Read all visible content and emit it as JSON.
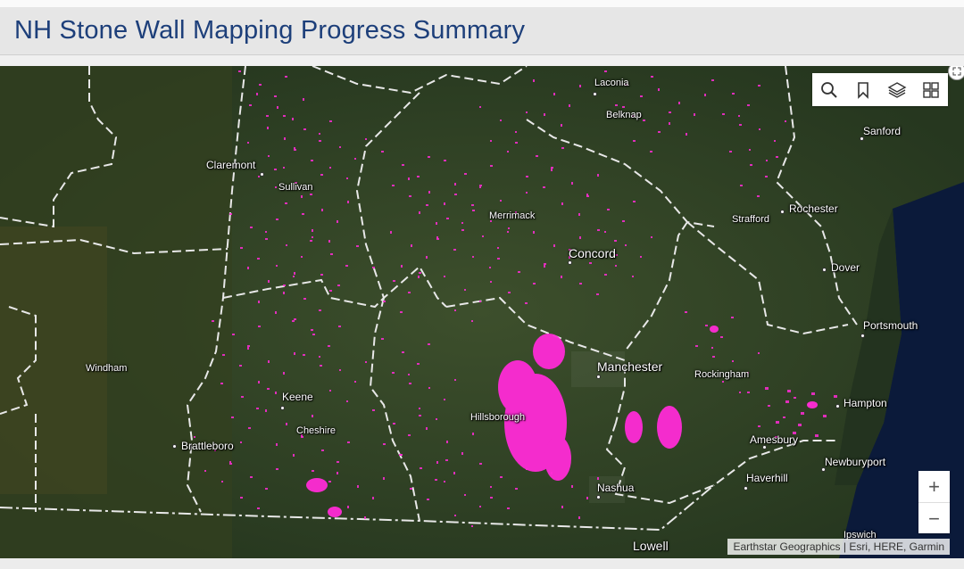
{
  "header": {
    "title": "NH Stone Wall Mapping Progress Summary"
  },
  "map": {
    "toolbar": [
      {
        "icon": "search-icon",
        "label": ""
      },
      {
        "icon": "bookmark-icon",
        "label": ""
      },
      {
        "icon": "layers-icon",
        "label": ""
      },
      {
        "icon": "basemap-gallery-icon",
        "label": ""
      }
    ],
    "zoom": {
      "in": "+",
      "out": "−"
    },
    "attribution": "Earthstar Geographics | Esri, HERE, Garmin",
    "labels": {
      "laconia": "Laconia",
      "belknap": "Belknap",
      "sanford": "Sanford",
      "claremont": "Claremont",
      "sullivan": "Sullivan",
      "merrimack": "Merrimack",
      "strafford": "Strafford",
      "rochester": "Rochester",
      "concord": "Concord",
      "dover": "Dover",
      "portsmouth": "Portsmouth",
      "windham": "Windham",
      "manchester": "Manchester",
      "rockingham": "Rockingham",
      "keene": "Keene",
      "hillsborough": "Hillsborough",
      "hampton": "Hampton",
      "cheshire": "Cheshire",
      "brattleboro": "Brattleboro",
      "amesbury": "Amesbury",
      "newburyport": "Newburyport",
      "haverhill": "Haverhill",
      "nashua": "Nashua",
      "lowell": "Lowell",
      "ipswich": "Ipswich"
    },
    "colors": {
      "walls": "#ff2bd6",
      "boundary": "#e8e8e8",
      "ocean": "#0b1a3a"
    }
  }
}
